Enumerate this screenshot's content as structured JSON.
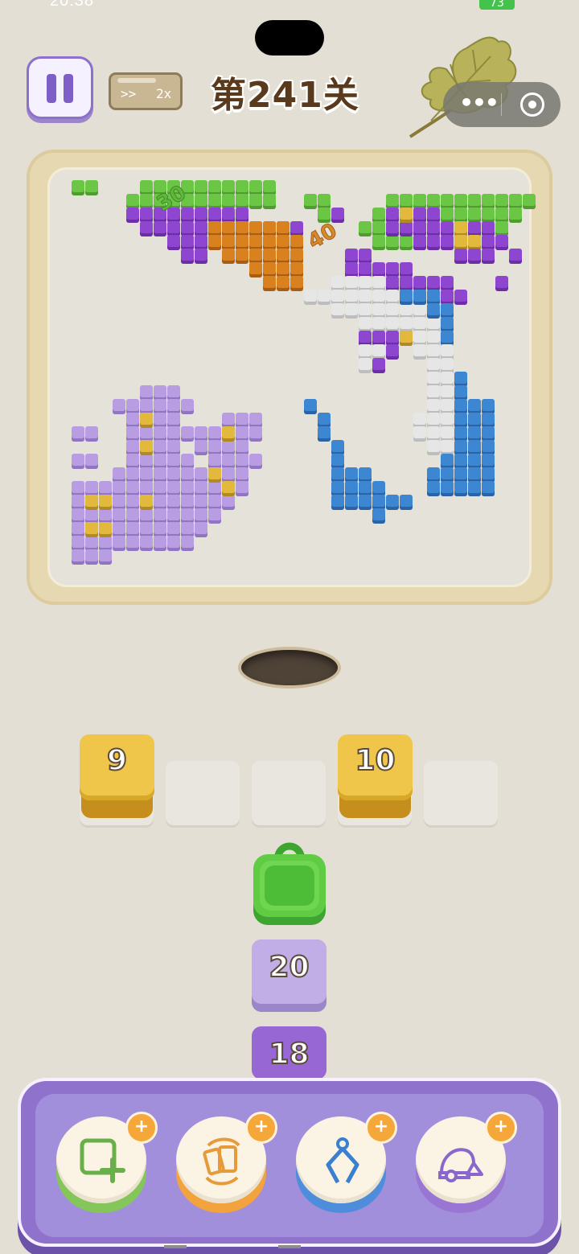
{
  "status": {
    "time": "20:38",
    "battery": "73"
  },
  "header": {
    "level_title": "第241关",
    "speed_arrows": ">>",
    "speed_multiplier": "2x",
    "more_icon": "more-dots-icon",
    "target_icon": "mini-program-close-icon"
  },
  "board": {
    "floating_numbers": [
      "30",
      "40"
    ],
    "colors": {
      "green": "#6cc645",
      "purple": "#8e45cf",
      "orange": "#d9801f",
      "white": "#e6e6e6",
      "blue": "#3c86d2",
      "lavender": "#b99de2",
      "gold": "#e2b93c"
    }
  },
  "tray": {
    "slots": [
      {
        "value": "9",
        "color": "yellow"
      },
      {
        "value": "",
        "color": "empty"
      },
      {
        "value": "",
        "color": "empty"
      },
      {
        "value": "10",
        "color": "yellow"
      },
      {
        "value": "",
        "color": "empty"
      }
    ]
  },
  "queue": [
    {
      "type": "bag",
      "color": "green",
      "icon": "shopping-bag-icon"
    },
    {
      "value": "20",
      "color": "lavender"
    },
    {
      "value": "18",
      "color": "purple"
    }
  ],
  "boosters": [
    {
      "name": "add-slot",
      "icon": "add-square-icon",
      "plus": "+",
      "accent": "#84c65a"
    },
    {
      "name": "shuffle",
      "icon": "shuffle-cards-icon",
      "plus": "+",
      "accent": "#f3a33d"
    },
    {
      "name": "claw",
      "icon": "claw-grabber-icon",
      "plus": "+",
      "accent": "#4d8ddc"
    },
    {
      "name": "vacuum",
      "icon": "vacuum-cleaner-icon",
      "plus": "+",
      "accent": "#9a76d4"
    }
  ]
}
